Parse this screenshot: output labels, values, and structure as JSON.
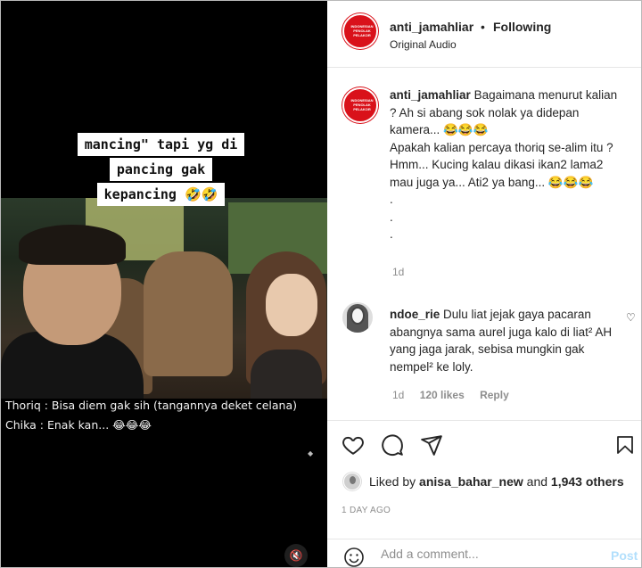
{
  "video": {
    "caption_lines": [
      "mancing\" tapi yg di",
      "pancing gak",
      "kepancing 🤣🤣"
    ],
    "subtitle_line1": "Thoriq : Bisa diem gak sih (tangannya deket celana)",
    "subtitle_line2": "Chika : Enak kan... 😂😂😂",
    "volume_icon": "🔇"
  },
  "header": {
    "username": "anti_jamahliar",
    "separator": "•",
    "follow_status": "Following",
    "audio": "Original Audio",
    "avatar_text": "INDONESIAN PENOLAK PELAKOR"
  },
  "caption": {
    "username": "anti_jamahliar",
    "text": "Bagaimana menurut kalian ? Ah si abang sok nolak ya didepan kamera... 😂😂😂",
    "text2": "Apakah kalian percaya thoriq se-alim itu ? Hmm... Kucing kalau dikasi ikan2 lama2 mau juga ya... Ati2 ya bang... 😂😂😂",
    "dots": ".",
    "age": "1d"
  },
  "reply": {
    "username": "ndoe_rie",
    "text": "Dulu liat jejak gaya pacaran abangnya sama aurel juga kalo di liat² AH yang jaga jarak, sebisa mungkin gak nempel² ke loly.",
    "age": "1d",
    "likes": "120 likes",
    "reply_label": "Reply",
    "heart_icon": "♡"
  },
  "actions": {
    "heart_icon": "heart-icon",
    "comment_icon": "comment-icon",
    "share_icon": "share-icon",
    "save_icon": "bookmark-icon"
  },
  "likes": {
    "prefix": "Liked by ",
    "user": "anisa_bahar_new",
    "middle": " and ",
    "others": "1,943 others"
  },
  "time_ago": "1 DAY AGO",
  "comment_box": {
    "placeholder": "Add a comment...",
    "post_label": "Post"
  }
}
